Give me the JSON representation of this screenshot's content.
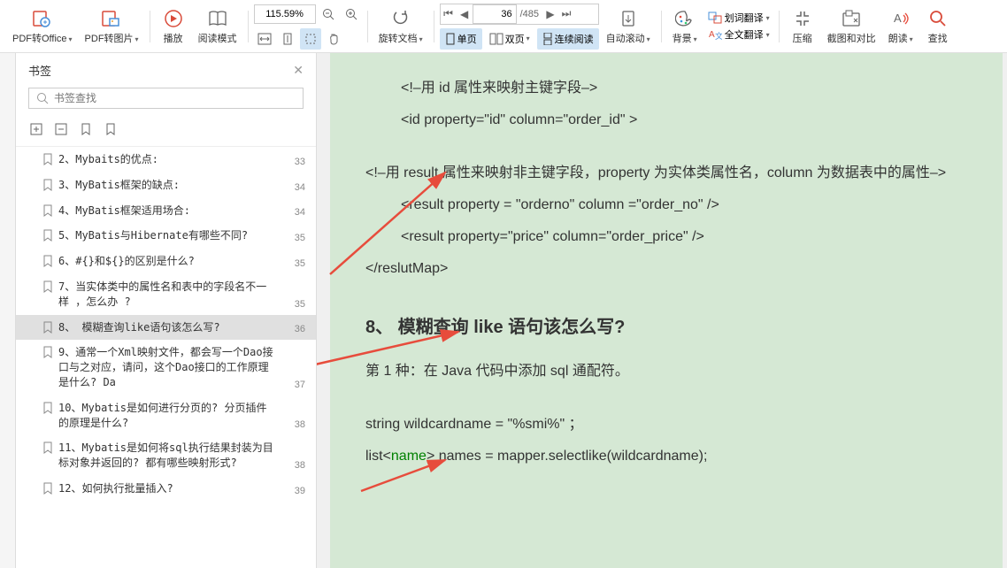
{
  "toolbar": {
    "pdf_office": "PDF转Office",
    "pdf_image": "PDF转图片",
    "play": "播放",
    "read_mode": "阅读模式",
    "rotate": "旋转文档",
    "single_page": "单页",
    "double_page": "双页",
    "continuous": "连续阅读",
    "auto_scroll": "自动滚动",
    "background": "背景",
    "word_translate": "划词翻译",
    "full_translate": "全文翻译",
    "compress": "压缩",
    "screenshot_compare": "截图和对比",
    "read_aloud": "朗读",
    "find": "查找",
    "zoom_value": "115.59%",
    "page_current": "36",
    "page_total": "/485"
  },
  "sidebar": {
    "title": "书签",
    "search_placeholder": "书签查找",
    "items": [
      {
        "text": "2、Mybaits的优点:",
        "page": "33"
      },
      {
        "text": "3、MyBatis框架的缺点:",
        "page": "34"
      },
      {
        "text": "4、MyBatis框架适用场合:",
        "page": "34"
      },
      {
        "text": "5、MyBatis与Hibernate有哪些不同?",
        "page": "35"
      },
      {
        "text": "6、#{}和${}的区别是什么?",
        "page": "35"
      },
      {
        "text": "7、当实体类中的属性名和表中的字段名不一样 ，怎么办 ?",
        "page": "35"
      },
      {
        "text": "8、 模糊查询like语句该怎么写?",
        "page": "36"
      },
      {
        "text": "9、通常一个Xml映射文件，都会写一个Dao接口与之对应，请问，这个Dao接口的工作原理是什么? Da",
        "page": "37"
      },
      {
        "text": "10、Mybatis是如何进行分页的? 分页插件的原理是什么?",
        "page": "38"
      },
      {
        "text": "11、Mybatis是如何将sql执行结果封装为目标对象并返回的? 都有哪些映射形式?",
        "page": "38"
      },
      {
        "text": "12、如何执行批量插入?",
        "page": "39"
      }
    ],
    "selected_index": 6
  },
  "content": {
    "comment1": "<!–用 id 属性来映射主键字段–>",
    "id_line": "<id property=\"id\"   column=\"order_id\"  >",
    "comment2": "<!–用 result 属性来映射非主键字段，property 为实体类属性名，column 为数据表中的属性–>",
    "result1": "<result property =  \"orderno\"   column =\"order_no\"  />",
    "result2": "<result property=\"price\"   column=\"order_price\"   />",
    "close_map": "</reslutMap>",
    "heading": "8、 模糊查询 like 语句该怎么写?",
    "desc": "第 1 种：在 Java 代码中添加 sql 通配符。",
    "code1": "string wildcardname =  \"%smi%\" ；",
    "code2_a": "list<",
    "code2_b": "name",
    "code2_c": "> names = mapper.selectlike(wildcardname);"
  }
}
